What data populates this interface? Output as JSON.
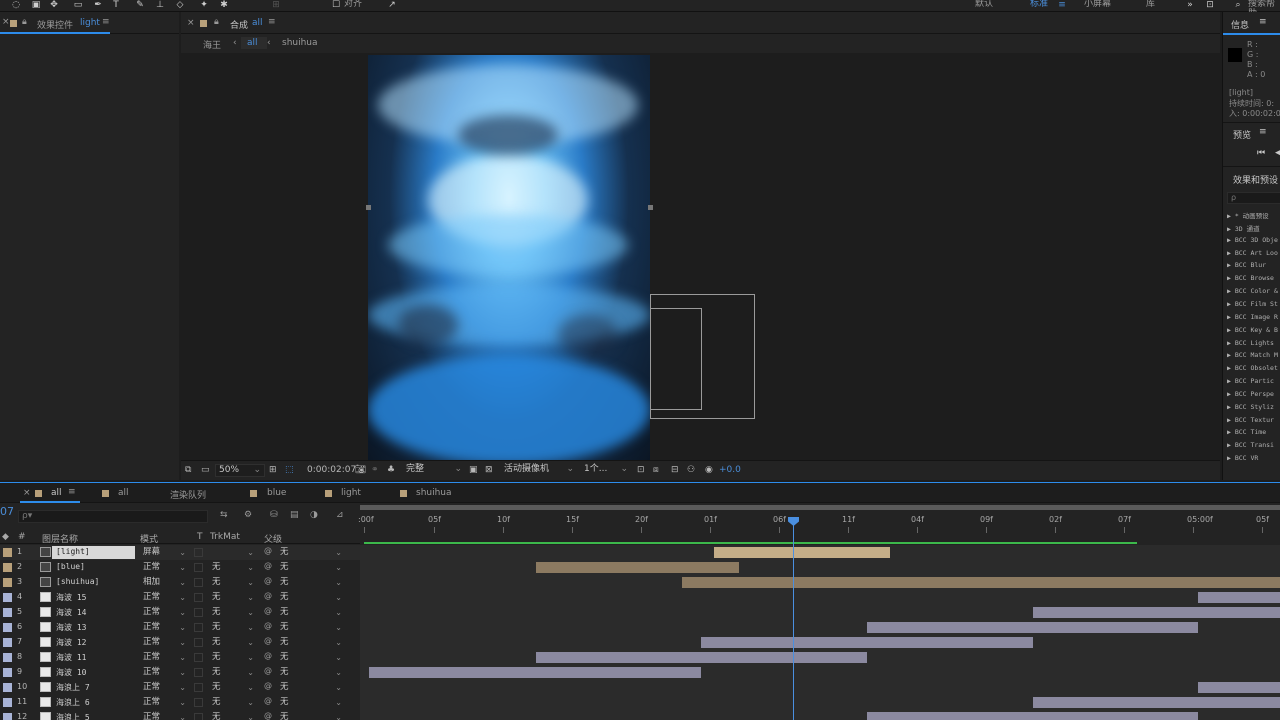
{
  "toolbar": {
    "snap_label": "对齐",
    "workspaces": [
      "默认",
      "标准",
      "小屏幕",
      "库"
    ],
    "active_workspace": "标准",
    "search_label": "搜索帮助"
  },
  "effects_panel": {
    "tab_label": "效果控件",
    "layer_name": "light"
  },
  "comp_panel": {
    "tab_label": "合成",
    "comp_name": "all",
    "breadcrumbs": [
      "海王",
      "all",
      "shuihua"
    ],
    "zoom": "50%",
    "timecode": "0:00:02:07",
    "resolution": "完整",
    "camera": "活动摄像机",
    "views": "1个...",
    "exposure": "+0.0"
  },
  "info_panel": {
    "title": "信息",
    "r": "R :",
    "g": "G :",
    "b": "B :",
    "a": "A : 0",
    "layer": "[light]",
    "duration_label": "持续时间: 0:",
    "in_label": "入: 0:00:02:0"
  },
  "preview_panel": {
    "title": "预览"
  },
  "effects_presets_panel": {
    "title": "效果和预设",
    "search_placeholder": "ρ",
    "items": [
      "▶ * 动画预设",
      "▶ 3D 通道",
      "▶ BCC 3D Obje",
      "▶ BCC Art Loo",
      "▶ BCC Blur",
      "▶ BCC Browse",
      "▶ BCC Color &",
      "▶ BCC Film St",
      "▶ BCC Image R",
      "▶ BCC Key & B",
      "▶ BCC Lights",
      "▶ BCC Match M",
      "▶ BCC Obsolet",
      "▶ BCC Partic",
      "▶ BCC Perspe",
      "▶ BCC Styliz",
      "▶ BCC Textur",
      "▶ BCC Time",
      "▶ BCC Transi",
      "▶ BCC VR"
    ]
  },
  "timeline": {
    "tabs": [
      "all",
      "all",
      "渲染队列",
      "blue",
      "light",
      "shuihua"
    ],
    "current_time_short": "07",
    "search_placeholder": "ρ▾",
    "headers": {
      "num": "#",
      "name": "图层名称",
      "mode": "模式",
      "t": "T",
      "trkmat": "TrkMat",
      "parent": "父级"
    },
    "ruler_labels": [
      ":00f",
      "05f",
      "10f",
      "15f",
      "20f",
      "01f",
      "06f",
      "11f",
      "04f",
      "09f",
      "02f",
      "07f",
      "05:00f",
      "05f"
    ],
    "layers": [
      {
        "num": "1",
        "name": "[light]",
        "mode": "屏幕",
        "trk": "",
        "parent": "无",
        "label_color": "#b8a07a",
        "icon": "comp",
        "selected": true,
        "bar": {
          "start_frame": 50.7,
          "end_frame": 76.3,
          "color": "tan"
        }
      },
      {
        "num": "2",
        "name": "[blue]",
        "mode": "正常",
        "trk": "无",
        "parent": "无",
        "label_color": "#b8a07a",
        "icon": "comp",
        "selected": false,
        "bar": {
          "start_frame": 24.9,
          "end_frame": 54.3,
          "color": "tan"
        }
      },
      {
        "num": "3",
        "name": "[shuihua]",
        "mode": "相加",
        "trk": "无",
        "parent": "无",
        "label_color": "#b8a07a",
        "icon": "comp",
        "selected": false,
        "bar": {
          "start_frame": 46.1,
          "end_frame": 133.0,
          "color": "tan"
        }
      },
      {
        "num": "4",
        "name": "海波 15",
        "mode": "正常",
        "trk": "无",
        "parent": "无",
        "label_color": "#a9b4d6",
        "icon": "file",
        "selected": false,
        "bar": {
          "start_frame": 120.8,
          "end_frame": 133.0,
          "color": "lav"
        }
      },
      {
        "num": "5",
        "name": "海波 14",
        "mode": "正常",
        "trk": "无",
        "parent": "无",
        "label_color": "#a9b4d6",
        "icon": "file",
        "selected": false,
        "bar": {
          "start_frame": 96.9,
          "end_frame": 133.0,
          "color": "lav"
        }
      },
      {
        "num": "6",
        "name": "海波 13",
        "mode": "正常",
        "trk": "无",
        "parent": "无",
        "label_color": "#a9b4d6",
        "icon": "file",
        "selected": false,
        "bar": {
          "start_frame": 72.9,
          "end_frame": 120.8,
          "color": "lav"
        }
      },
      {
        "num": "7",
        "name": "海波 12",
        "mode": "正常",
        "trk": "无",
        "parent": "无",
        "label_color": "#a9b4d6",
        "icon": "file",
        "selected": false,
        "bar": {
          "start_frame": 48.9,
          "end_frame": 96.9,
          "color": "lav"
        }
      },
      {
        "num": "8",
        "name": "海波 11",
        "mode": "正常",
        "trk": "无",
        "parent": "无",
        "label_color": "#a9b4d6",
        "icon": "file",
        "selected": false,
        "bar": {
          "start_frame": 24.9,
          "end_frame": 72.9,
          "color": "lav"
        }
      },
      {
        "num": "9",
        "name": "海波 10",
        "mode": "正常",
        "trk": "无",
        "parent": "无",
        "label_color": "#a9b4d6",
        "icon": "file",
        "selected": false,
        "bar": {
          "start_frame": 0.7,
          "end_frame": 48.9,
          "color": "lav"
        }
      },
      {
        "num": "10",
        "name": "海浪上 7",
        "mode": "正常",
        "trk": "无",
        "parent": "无",
        "label_color": "#a9b4d6",
        "icon": "file",
        "selected": false,
        "bar": {
          "start_frame": 120.8,
          "end_frame": 133.0,
          "color": "lav"
        }
      },
      {
        "num": "11",
        "name": "海浪上 6",
        "mode": "正常",
        "trk": "无",
        "parent": "无",
        "label_color": "#a9b4d6",
        "icon": "file",
        "selected": false,
        "bar": {
          "start_frame": 96.9,
          "end_frame": 133.0,
          "color": "lav"
        }
      },
      {
        "num": "12",
        "name": "海浪上 5",
        "mode": "正常",
        "trk": "无",
        "parent": "无",
        "label_color": "#a9b4d6",
        "icon": "file",
        "selected": false,
        "bar": {
          "start_frame": 72.9,
          "end_frame": 120.8,
          "color": "lav"
        }
      }
    ]
  }
}
